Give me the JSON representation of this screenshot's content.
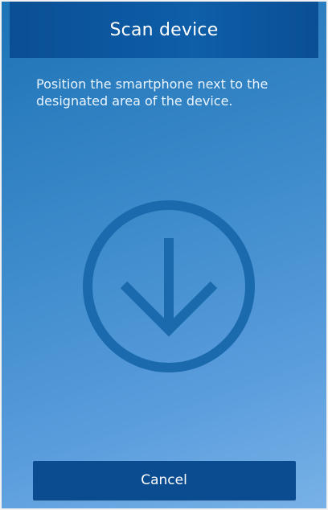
{
  "header": {
    "title": "Scan device"
  },
  "content": {
    "instruction_text": "Position the smartphone next to the designated area of the device.",
    "graphic_icon": "down-arrow-circle-icon"
  },
  "footer": {
    "cancel_label": "Cancel"
  },
  "colors": {
    "header_bg": "#0e5ea8",
    "background_start": "#1c73b6",
    "background_end": "#78b1e6",
    "icon_stroke": "#1a6aad",
    "button_bg": "#0b4c91",
    "text_primary": "#ffffff"
  }
}
